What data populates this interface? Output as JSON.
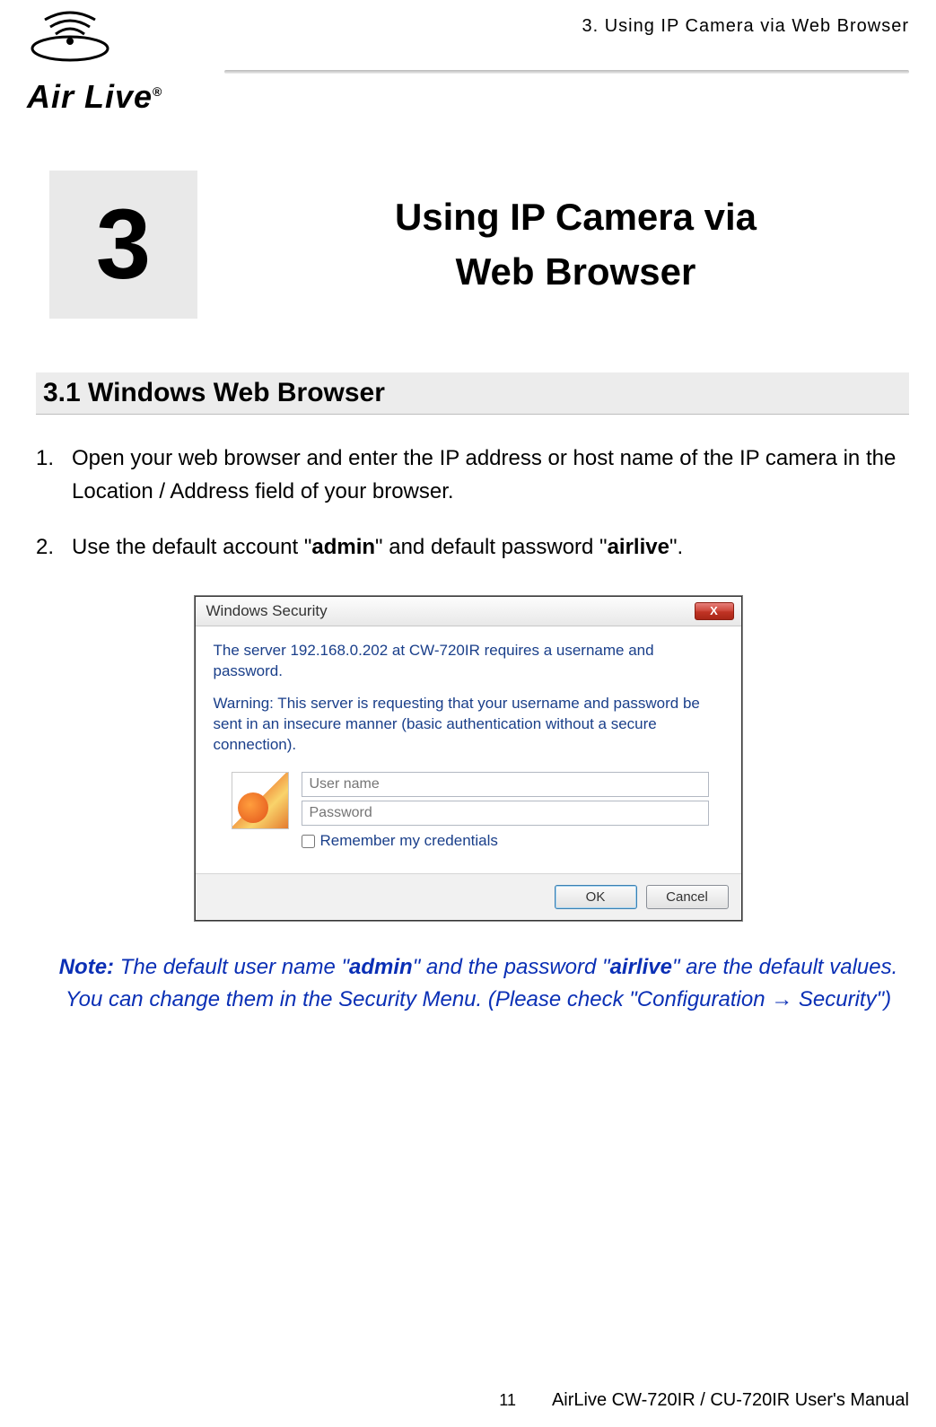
{
  "header": {
    "logo_text": "Air Live",
    "logo_reg": "®",
    "right_text": "3. Using IP Camera via Web Browser"
  },
  "chapter": {
    "number": "3",
    "title_line1": "Using IP Camera via",
    "title_line2": "Web Browser"
  },
  "section": {
    "heading": "3.1 Windows Web Browser"
  },
  "steps": {
    "n1": "1.",
    "t1": "Open your web browser and enter the IP address or host name of the IP camera in the Location / Address field of your browser.",
    "n2": "2.",
    "t2_a": "Use the default account \"",
    "t2_b": "admin",
    "t2_c": "\" and default password \"",
    "t2_d": "airlive",
    "t2_e": "\"."
  },
  "dialog": {
    "title": "Windows Security",
    "close": "X",
    "line1_a": "The server 192.168.0.202 at ",
    "line1_b": "CW-720IR",
    "line1_c": " requires a username and password.",
    "line2": "Warning: This server is requesting that your username and password be sent in an insecure manner (basic authentication without a secure connection).",
    "user_ph": "User name",
    "pass_ph": "Password",
    "remember": "Remember my credentials",
    "ok": "OK",
    "cancel": "Cancel"
  },
  "note": {
    "label": "Note:",
    "p1": " The default user name \"",
    "b1": "admin",
    "p2": "\" and the password \"",
    "b2": "airlive",
    "p3": "\" are the default values. You can change them in the Security Menu. (Please check \"Configuration → Security\")"
  },
  "footer": {
    "page": "11",
    "manual": "AirLive CW-720IR / CU-720IR User's Manual"
  }
}
